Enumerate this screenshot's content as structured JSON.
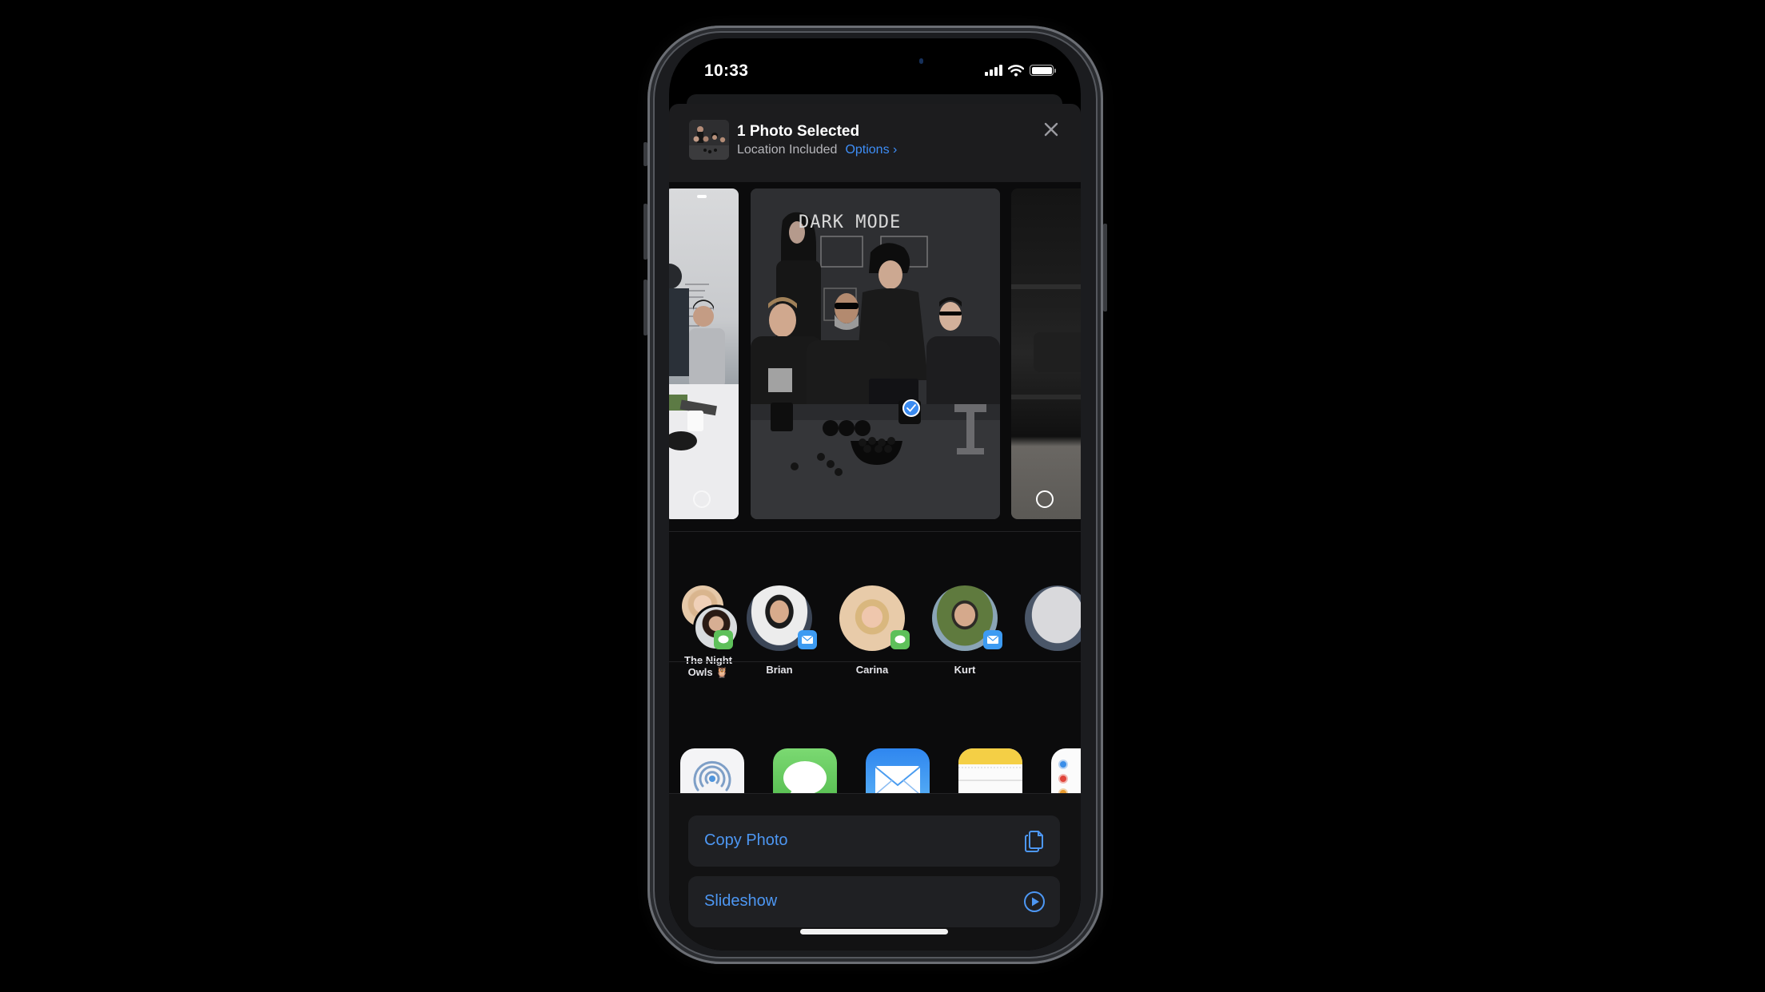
{
  "status_bar": {
    "time": "10:33",
    "icons": [
      "cellular-signal-icon",
      "wifi-icon",
      "battery-icon"
    ]
  },
  "share_sheet": {
    "header": {
      "title": "1 Photo Selected",
      "subtitle": "Location Included",
      "options_label": "Options",
      "options_chevron": "›",
      "close_icon": "close-icon"
    },
    "photos": [
      {
        "name": "office-whiteboard-photo",
        "selected": false
      },
      {
        "name": "dark-mode-team-photo",
        "selected": true,
        "caption_on_wall": "DARK MODE"
      },
      {
        "name": "dark-room-photo",
        "selected": false
      }
    ],
    "contacts": [
      {
        "name": "The Night Owls 🦉",
        "line1": "The Night",
        "line2": "Owls 🦉",
        "badge": "messages",
        "group": true
      },
      {
        "name": "Brian",
        "badge": "mail"
      },
      {
        "name": "Carina",
        "badge": "messages"
      },
      {
        "name": "Kurt",
        "badge": "mail"
      },
      {
        "name": "",
        "badge": "",
        "partial": true
      }
    ],
    "apps": [
      {
        "label": "AirDrop",
        "icon": "airdrop-icon"
      },
      {
        "label": "Messages",
        "icon": "messages-icon"
      },
      {
        "label": "Mail",
        "icon": "mail-icon"
      },
      {
        "label": "Notes",
        "icon": "notes-icon"
      },
      {
        "label": "Rei",
        "icon": "reminders-icon",
        "partial": true
      }
    ],
    "actions": [
      {
        "label": "Copy Photo",
        "icon": "copy-icon"
      },
      {
        "label": "Slideshow",
        "icon": "play-circle-icon"
      }
    ]
  },
  "colors": {
    "accent": "#3e8ef7",
    "sheet_header": "#1c1c1e",
    "action_row": "#1f2023",
    "messages_green": "#5ec05a",
    "mail_blue": "#3d9bf2",
    "notes_yellow": "#f4cf45"
  }
}
